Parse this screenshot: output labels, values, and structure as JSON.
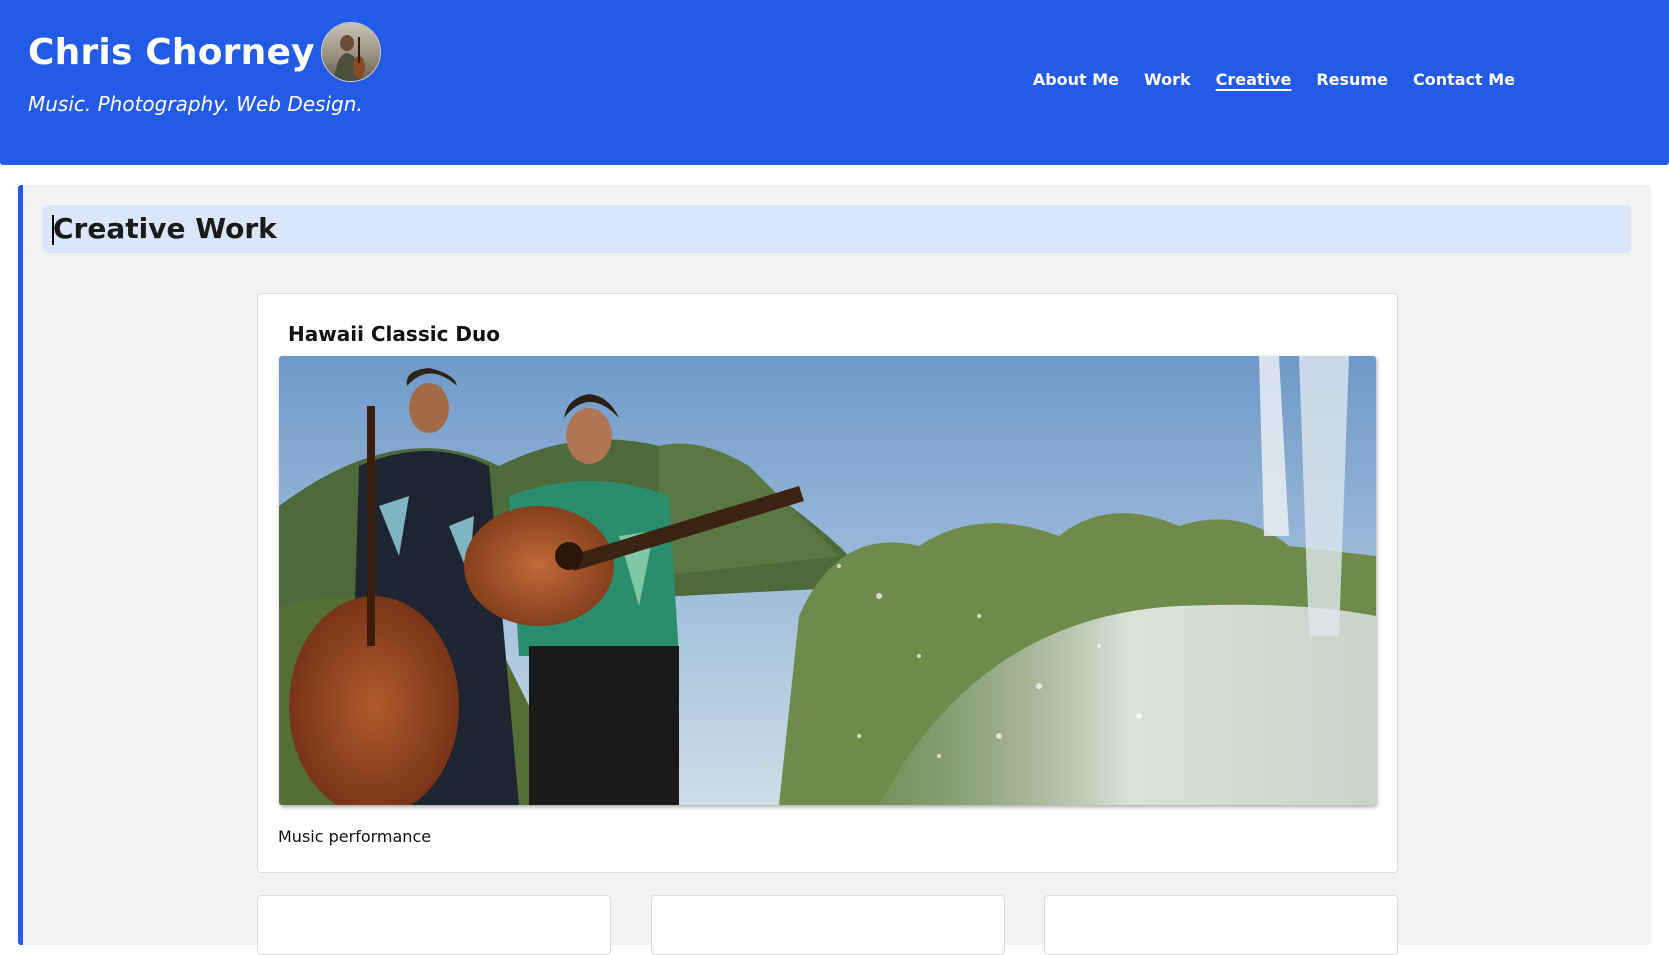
{
  "header": {
    "site_title": "Chris Chorney",
    "tagline": "Music. Photography. Web Design.",
    "brand_color": "#235ae6",
    "nav": [
      {
        "label": "About Me",
        "active": false
      },
      {
        "label": "Work",
        "active": false
      },
      {
        "label": "Creative",
        "active": true
      },
      {
        "label": "Resume",
        "active": false
      },
      {
        "label": "Contact Me",
        "active": false
      }
    ]
  },
  "main": {
    "page_title": "Creative Work",
    "cards": [
      {
        "title": "Hawaii Classic Duo",
        "image_alt": "Cellist and guitarist performing outdoors by a fountain",
        "caption": "Music performance"
      }
    ]
  }
}
